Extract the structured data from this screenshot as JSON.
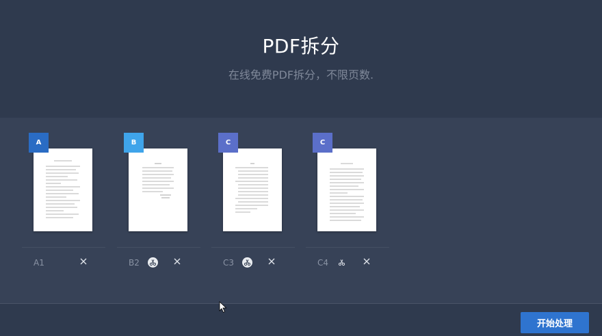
{
  "header": {
    "title": "PDF拆分",
    "subtitle": "在线免费PDF拆分，不限页数."
  },
  "cards": [
    {
      "badge": "A",
      "badge_color": "#2a6cc4",
      "label": "A1",
      "split_icon": "none"
    },
    {
      "badge": "B",
      "badge_color": "#3fa4ea",
      "label": "B2",
      "split_icon": "scissors-circle"
    },
    {
      "badge": "C",
      "badge_color": "#5b6fc9",
      "label": "C3",
      "split_icon": "scissors-circle"
    },
    {
      "badge": "C",
      "badge_color": "#5b6fc9",
      "label": "C4",
      "split_icon": "scissors"
    }
  ],
  "footer": {
    "start_label": "开始处理"
  }
}
